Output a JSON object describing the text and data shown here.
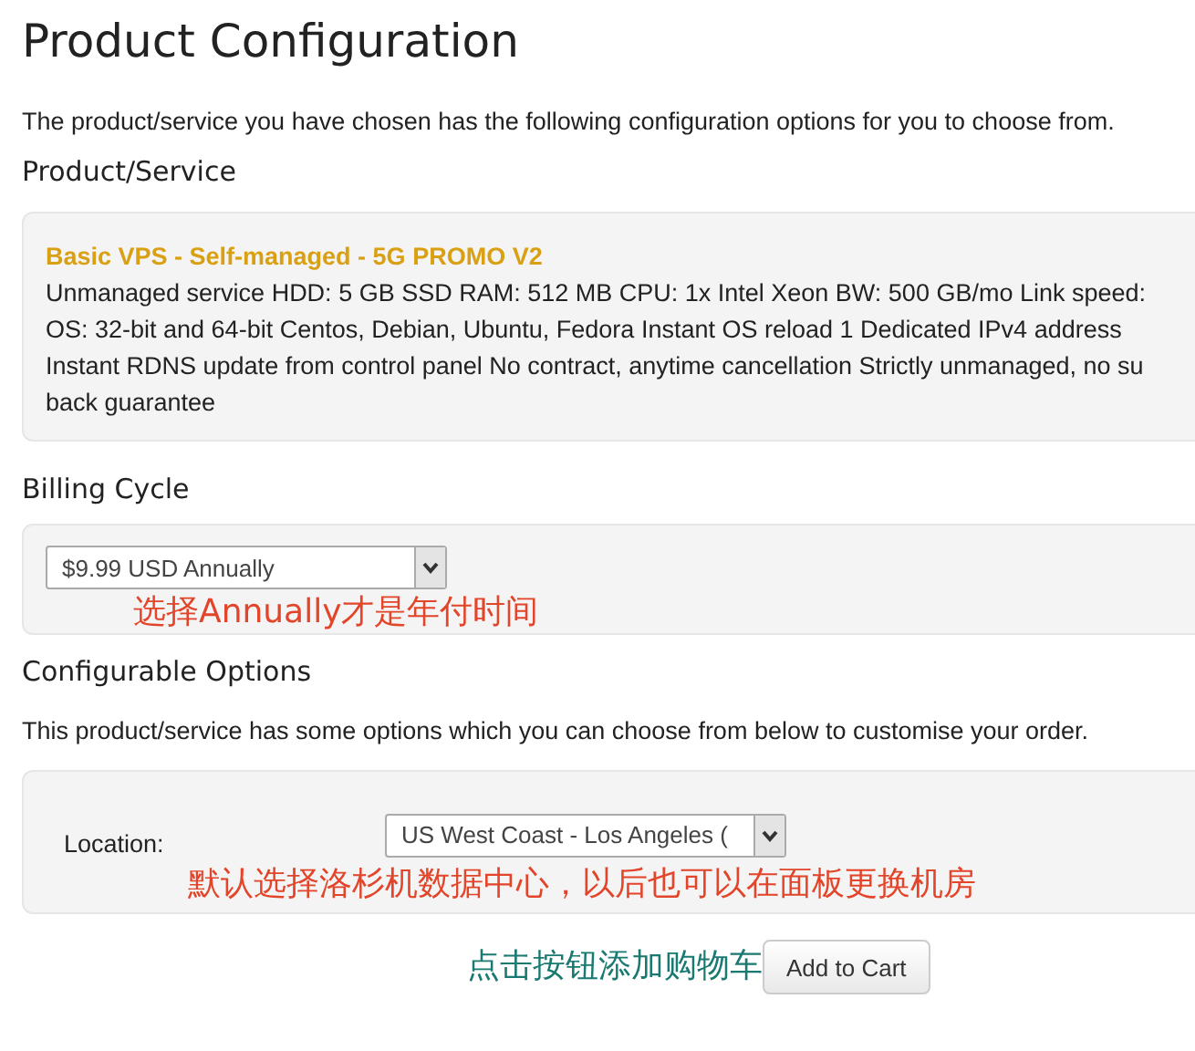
{
  "title": "Product Configuration",
  "intro": "The product/service you have chosen has the following configuration options for you to choose from.",
  "product_section": {
    "heading": "Product/Service",
    "name": "Basic VPS - Self-managed - 5G PROMO V2",
    "description_lines": [
      "Unmanaged service HDD: 5 GB SSD RAM: 512 MB CPU: 1x Intel Xeon BW: 500 GB/mo Link speed:",
      "OS: 32-bit and 64-bit Centos, Debian, Ubuntu, Fedora Instant OS reload 1 Dedicated IPv4 address",
      "Instant RDNS update from control panel No contract, anytime cancellation Strictly unmanaged, no su",
      "back guarantee"
    ]
  },
  "billing_section": {
    "heading": "Billing Cycle",
    "select_value": "$9.99 USD Annually",
    "annotation": "选择Annually才是年付时间"
  },
  "options_section": {
    "heading": "Configurable Options",
    "description": "This product/service has some options which you can choose from below to customise your order.",
    "options": [
      {
        "label": "Location:",
        "select_value": "US West Coast - Los Angeles (",
        "annotation": "默认选择洛杉机数据中心，以后也可以在面板更换机房"
      }
    ]
  },
  "cart": {
    "annotation": "点击按钮添加购物车",
    "button": "Add to Cart"
  }
}
